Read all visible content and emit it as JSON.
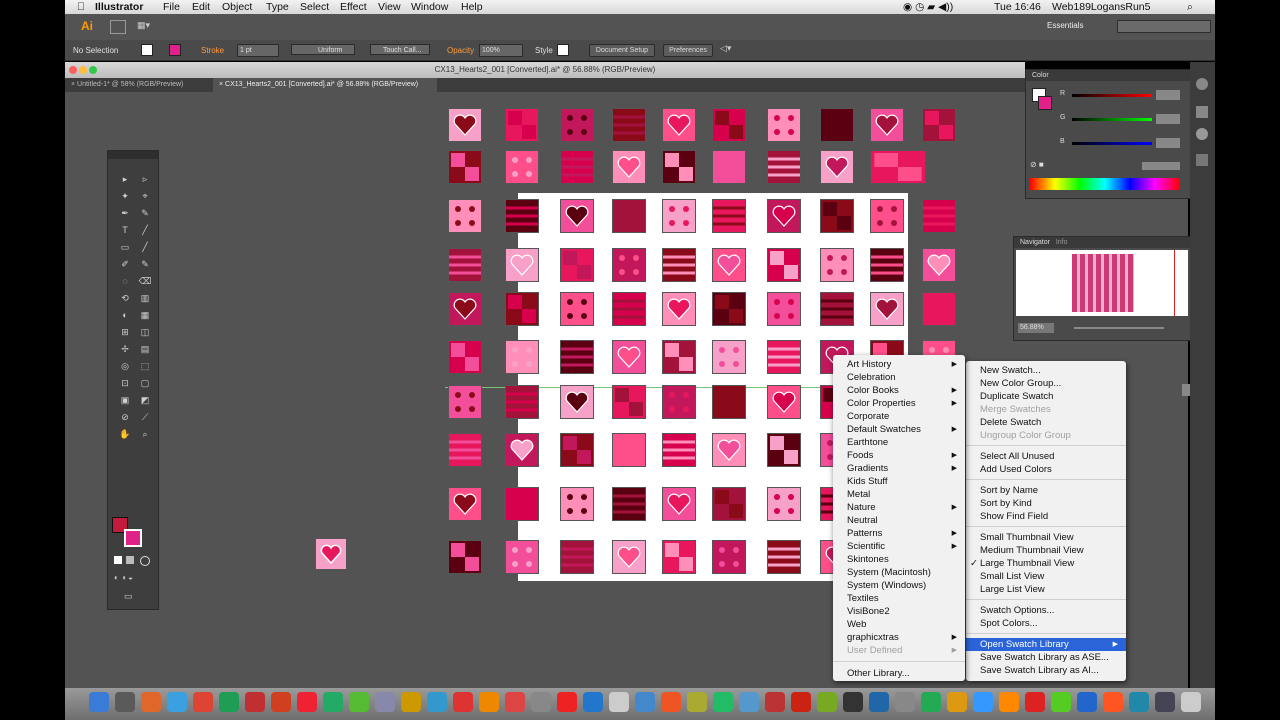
{
  "menubar": {
    "apple": "",
    "app_name": "Illustrator",
    "items": [
      "File",
      "Edit",
      "Object",
      "Type",
      "Select",
      "Effect",
      "View",
      "Window",
      "Help"
    ],
    "clock": "Tue 16:46",
    "user": "Web189LogansRun5"
  },
  "appbar": {
    "logo": "Ai",
    "workspace": "Essentials"
  },
  "control": {
    "selection": "No Selection",
    "stroke_label": "Stroke",
    "stroke_weight": "1 pt",
    "stroke_profile": "Uniform",
    "brush": "Touch Call...",
    "opacity_label": "Opacity",
    "opacity": "100%",
    "style_label": "Style",
    "doc_setup": "Document Setup",
    "preferences": "Preferences"
  },
  "document": {
    "title": "CX13_Hearts2_001 [Converted].ai* @ 56.88% (RGB/Preview)",
    "tabs": [
      {
        "label": "Untitled-1* @ 58% (RGB/Preview)"
      },
      {
        "label": "CX13_Hearts2_001 [Converted].ai* @ 56.88% (RGB/Preview)"
      }
    ]
  },
  "panels": {
    "color": {
      "title": "Color",
      "channels": [
        "R",
        "G",
        "B"
      ]
    },
    "navigator": {
      "tabs": [
        "Navigator",
        "Info"
      ],
      "zoom": "56.88%"
    }
  },
  "swatch_menu": {
    "items": [
      {
        "label": "New Swatch...",
        "state": "normal"
      },
      {
        "label": "New Color Group...",
        "state": "normal"
      },
      {
        "label": "Duplicate Swatch",
        "state": "normal"
      },
      {
        "label": "Merge Swatches",
        "state": "disabled"
      },
      {
        "label": "Delete Swatch",
        "state": "normal"
      },
      {
        "label": "Ungroup Color Group",
        "state": "disabled"
      },
      {
        "sep": true
      },
      {
        "label": "Select All Unused",
        "state": "normal"
      },
      {
        "label": "Add Used Colors",
        "state": "normal"
      },
      {
        "sep": true
      },
      {
        "label": "Sort by Name",
        "state": "normal"
      },
      {
        "label": "Sort by Kind",
        "state": "normal"
      },
      {
        "label": "Show Find Field",
        "state": "normal"
      },
      {
        "sep": true
      },
      {
        "label": "Small Thumbnail View",
        "state": "normal"
      },
      {
        "label": "Medium Thumbnail View",
        "state": "normal"
      },
      {
        "label": "Large Thumbnail View",
        "state": "checked"
      },
      {
        "label": "Small List View",
        "state": "normal"
      },
      {
        "label": "Large List View",
        "state": "normal"
      },
      {
        "sep": true
      },
      {
        "label": "Swatch Options...",
        "state": "normal"
      },
      {
        "label": "Spot Colors...",
        "state": "normal"
      },
      {
        "sep": true
      },
      {
        "label": "Open Swatch Library",
        "state": "highlighted",
        "submenu": true
      },
      {
        "label": "Save Swatch Library as ASE...",
        "state": "normal"
      },
      {
        "label": "Save Swatch Library as AI...",
        "state": "normal"
      }
    ]
  },
  "library_menu": {
    "items": [
      {
        "label": "Art History",
        "submenu": true
      },
      {
        "label": "Celebration"
      },
      {
        "label": "Color Books",
        "submenu": true
      },
      {
        "label": "Color Properties",
        "submenu": true
      },
      {
        "label": "Corporate"
      },
      {
        "label": "Default Swatches",
        "submenu": true
      },
      {
        "label": "Earthtone"
      },
      {
        "label": "Foods",
        "submenu": true
      },
      {
        "label": "Gradients",
        "submenu": true
      },
      {
        "label": "Kids Stuff"
      },
      {
        "label": "Metal"
      },
      {
        "label": "Nature",
        "submenu": true
      },
      {
        "label": "Neutral"
      },
      {
        "label": "Patterns",
        "submenu": true
      },
      {
        "label": "Scientific",
        "submenu": true
      },
      {
        "label": "Skintones"
      },
      {
        "label": "System (Macintosh)"
      },
      {
        "label": "System (Windows)"
      },
      {
        "label": "Textiles"
      },
      {
        "label": "VisiBone2"
      },
      {
        "label": "Web"
      },
      {
        "label": "graphicxtras",
        "submenu": true
      },
      {
        "label": "User Defined",
        "submenu": true,
        "disabled": true
      },
      {
        "sep": true
      },
      {
        "label": "Other Library..."
      }
    ]
  },
  "colors": {
    "canvas_bg": "#535353",
    "menu_highlight": "#2b64d8",
    "swatch_palette": [
      "#f7a1c8",
      "#e8175d",
      "#c2185b",
      "#8b0a1a",
      "#ff4f8b",
      "#d6004c",
      "#ff8fb8",
      "#5a0010",
      "#f24e9a",
      "#a3123a"
    ]
  }
}
